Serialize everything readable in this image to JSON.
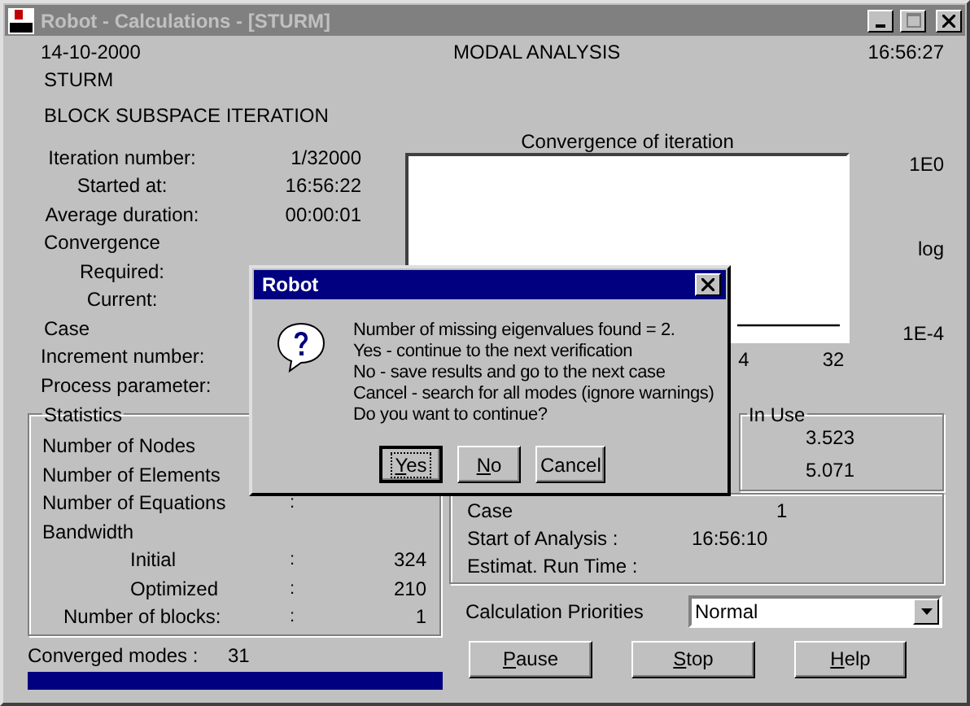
{
  "window": {
    "title": "Robot - Calculations - [STURM]",
    "active": false
  },
  "header": {
    "date": "14-10-2000",
    "mode": "MODAL ANALYSIS",
    "time": "16:56:27",
    "project": "STURM",
    "method": "BLOCK SUBSPACE ITERATION"
  },
  "info_rows": [
    {
      "kind": "item",
      "label": "Iteration number:",
      "value": "1/32000"
    },
    {
      "kind": "item",
      "label": "Started at:",
      "value": "16:56:22"
    },
    {
      "kind": "item",
      "label": "Average duration:",
      "value": "00:00:01"
    },
    {
      "kind": "section",
      "label": "Convergence"
    },
    {
      "kind": "item",
      "label": "Required:"
    },
    {
      "kind": "item",
      "label": "Current:"
    },
    {
      "kind": "section",
      "label": "Case"
    },
    {
      "kind": "item",
      "label": "Increment number:"
    },
    {
      "kind": "item",
      "label": "Process parameter:"
    }
  ],
  "chart": {
    "title": "Convergence of iteration",
    "y_labels": [
      "1E0",
      "log",
      "1E-4"
    ],
    "x_labels": [
      "4",
      "32"
    ]
  },
  "statistics": {
    "title": "Statistics",
    "rows": [
      {
        "kind": "section",
        "label": "Number of Nodes"
      },
      {
        "kind": "section",
        "label": "Number of Elements"
      },
      {
        "kind": "section",
        "label": "Number of Equations",
        "separator": ":"
      },
      {
        "kind": "section",
        "label": "Bandwidth"
      },
      {
        "kind": "sub",
        "label": "Initial",
        "separator": ":",
        "value": "324"
      },
      {
        "kind": "sub",
        "label": "Optimized",
        "separator": ":",
        "value": "210"
      },
      {
        "kind": "item",
        "label": "Number of blocks:",
        "separator": ":",
        "value": "1"
      }
    ]
  },
  "converged": {
    "label": "Converged modes :",
    "value": "31",
    "level": 1
  },
  "in_use": {
    "title": "In Use",
    "values": [
      "3.523",
      "5.071"
    ]
  },
  "run_info": [
    {
      "label": "Case",
      "value": "1"
    },
    {
      "label": "Start of Analysis :",
      "value": "16:56:10"
    },
    {
      "label": "Estimat. Run Time :"
    }
  ],
  "priorities": {
    "label": "Calculation Priorities",
    "value": "Normal"
  },
  "buttons": [
    {
      "accel": "P",
      "rest": "ause"
    },
    {
      "accel": "S",
      "rest": "top"
    },
    {
      "accel": "H",
      "rest": "elp"
    }
  ],
  "dialog": {
    "title": "Robot",
    "lines": [
      "Number of missing eigenvalues found = 2.",
      "Yes - continue to the next verification",
      "No - save results and go to the next case",
      "Cancel - search for all modes (ignore warnings)",
      "Do you want to continue?"
    ],
    "buttons": [
      {
        "accel": "Y",
        "rest": "es",
        "focused": true
      },
      {
        "accel": "N",
        "rest": "o",
        "focused": false
      },
      {
        "rest": "Cancel",
        "focused": false
      }
    ]
  }
}
